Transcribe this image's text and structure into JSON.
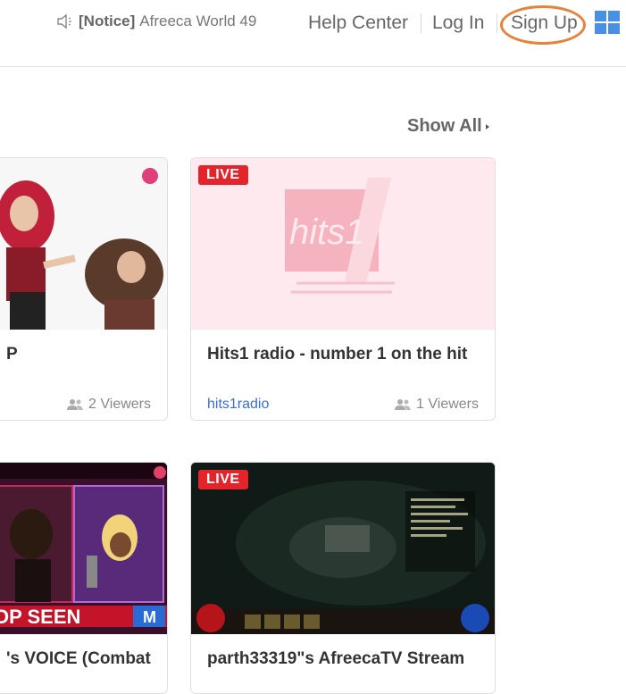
{
  "header": {
    "notice_tag": "[Notice]",
    "notice_text": "Afreeca World 49",
    "help_center": "Help Center",
    "log_in": "Log In",
    "sign_up": "Sign Up"
  },
  "section": {
    "show_all": "Show All"
  },
  "cards": [
    {
      "title": "P",
      "channel": "",
      "viewers": "2 Viewers"
    },
    {
      "live": "LIVE",
      "title": "Hits1 radio - number 1 on the hit",
      "channel": "hits1radio",
      "viewers": "1 Viewers",
      "thumb_logo": "hits1"
    },
    {
      "title": "'s VOICE (Combat",
      "thumb_text": "OP SEEN",
      "thumb_badge": "M"
    },
    {
      "live": "LIVE",
      "title": "parth33319\"s AfreecaTV Stream"
    }
  ],
  "colors": {
    "live": "#e3242b",
    "accent": "#3b6fd4",
    "highlight": "#e8823a",
    "grid_icon": "#4a90e2"
  }
}
